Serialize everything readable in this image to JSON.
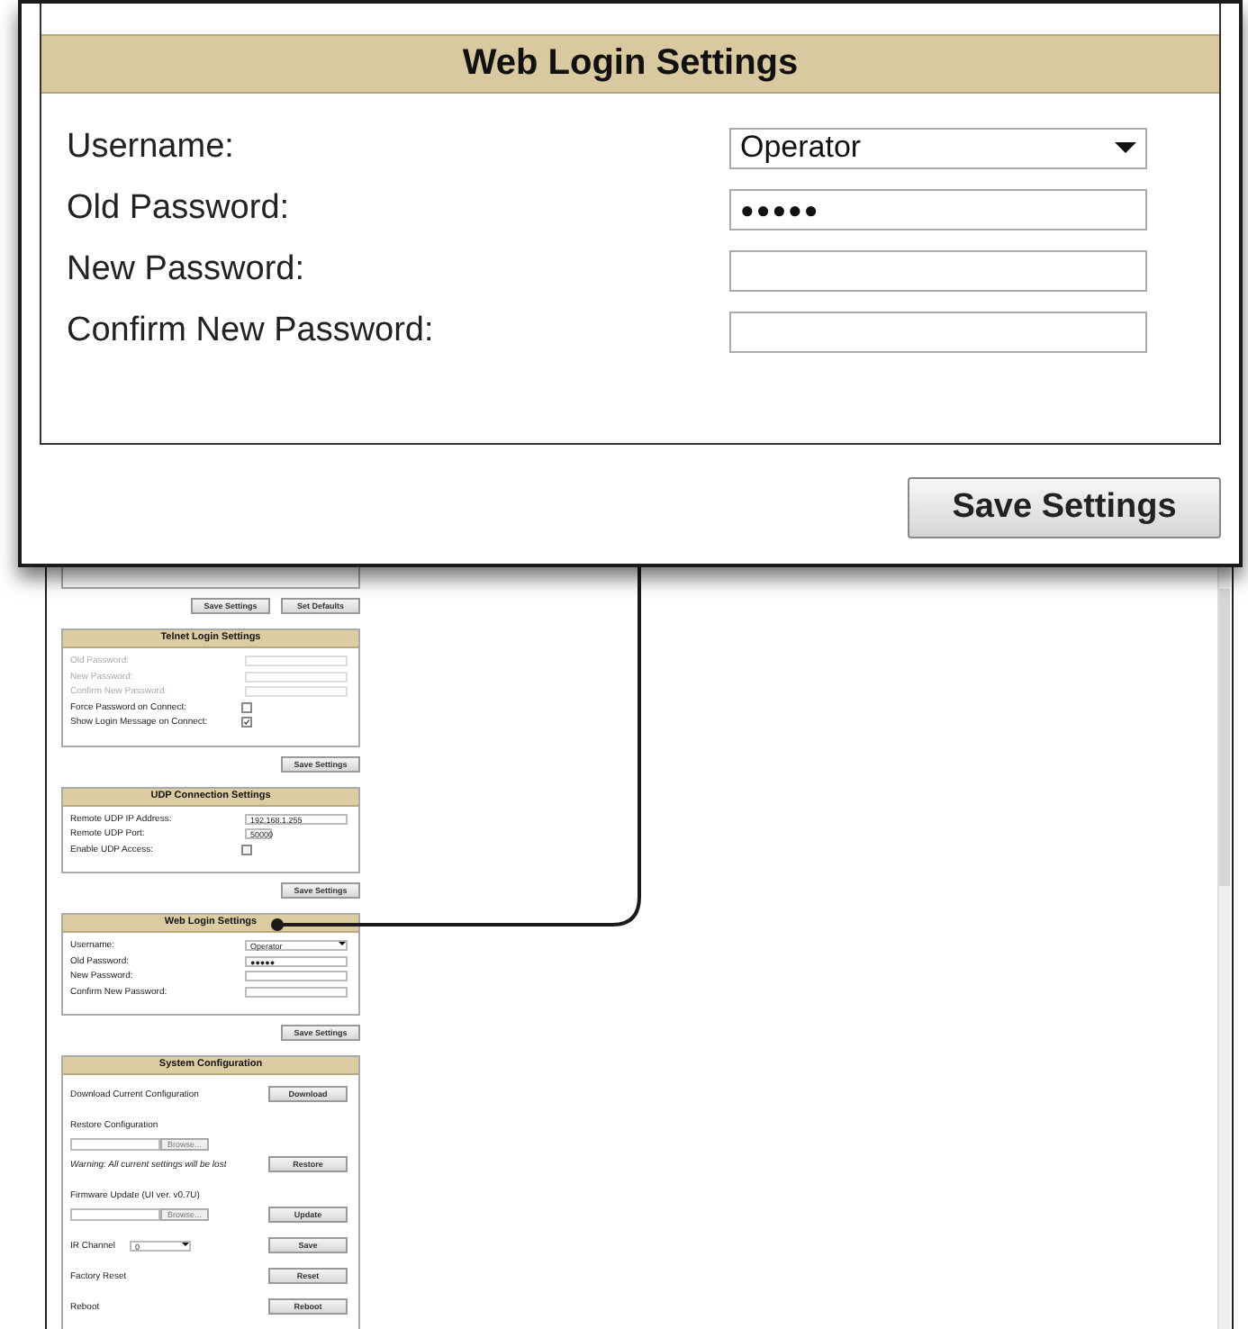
{
  "callout": {
    "title": "Web Login Settings",
    "rows": [
      {
        "label": "Username:",
        "kind": "select",
        "value": "Operator"
      },
      {
        "label": "Old Password:",
        "kind": "text",
        "value": "●●●●●"
      },
      {
        "label": "New Password:",
        "kind": "text"
      },
      {
        "label": "Confirm New Password:",
        "kind": "text"
      }
    ],
    "button": "Save Settings"
  },
  "page": {
    "top_buttons": [
      "Save Settings",
      "Set Defaults"
    ],
    "sections": [
      {
        "title": "Telnet Login Settings",
        "rows": [
          {
            "label": "Old Password:",
            "kind": "text",
            "disabled": true
          },
          {
            "label": "New Password:",
            "kind": "text",
            "disabled": true
          },
          {
            "label": "Confirm New Password:",
            "kind": "text",
            "disabled": true
          },
          {
            "label": "Force Password on Connect:",
            "kind": "checkbox",
            "checked": false,
            "disabled": false
          },
          {
            "label": "Show Login Message on Connect:",
            "kind": "checkbox",
            "checked": true,
            "disabled": false
          }
        ],
        "button": "Save Settings"
      },
      {
        "title": "UDP Connection Settings",
        "rows": [
          {
            "label": "Remote UDP IP Address:",
            "kind": "text",
            "value": "192.168.1.255"
          },
          {
            "label": "Remote UDP Port:",
            "kind": "short",
            "value": "50000"
          },
          {
            "label": "Enable UDP Access:",
            "kind": "checkbox",
            "checked": false
          }
        ],
        "button": "Save Settings"
      },
      {
        "title": "Web Login Settings",
        "rows": [
          {
            "label": "Username:",
            "kind": "select",
            "value": "Operator"
          },
          {
            "label": "Old Password:",
            "kind": "text",
            "value": "●●●●●"
          },
          {
            "label": "New Password:",
            "kind": "text"
          },
          {
            "label": "Confirm New Password:",
            "kind": "text"
          }
        ],
        "button": "Save Settings"
      }
    ],
    "system": {
      "title": "System Configuration",
      "items": [
        {
          "kind": "action",
          "label": "Download Current Configuration",
          "button": "Download"
        },
        {
          "kind": "label",
          "label": "Restore Configuration"
        },
        {
          "kind": "file",
          "browse": "Browse..."
        },
        {
          "kind": "warning",
          "label": "Warning: All current settings will be lost",
          "button": "Restore"
        },
        {
          "kind": "label",
          "label": "Firmware Update (UI ver. v0.7U)"
        },
        {
          "kind": "file",
          "browse": "Browse...",
          "button": "Update"
        },
        {
          "kind": "select",
          "label": "IR Channel",
          "value": "0",
          "button": "Save"
        },
        {
          "kind": "action",
          "label": "Factory Reset",
          "button": "Reset"
        },
        {
          "kind": "action",
          "label": "Reboot",
          "button": "Reboot"
        }
      ]
    }
  }
}
